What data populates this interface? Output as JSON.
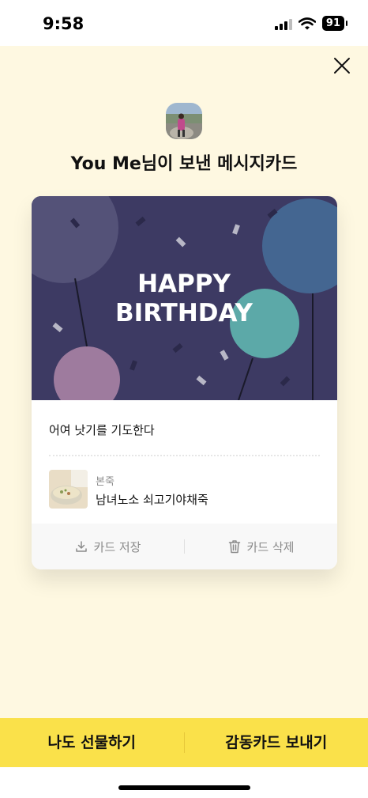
{
  "status_bar": {
    "time": "9:58",
    "battery": "91",
    "signal_icon": "cellular-signal-icon",
    "wifi_icon": "wifi-icon"
  },
  "header": {
    "close_icon": "close-icon",
    "title": "You Me님이 보낸 메시지카드"
  },
  "card": {
    "art": {
      "line1": "HAPPY",
      "line2": "BIRTHDAY",
      "background": "#3d3a63"
    },
    "message": "어여 낫기를 기도한다",
    "gift": {
      "brand": "본죽",
      "name": "남녀노소 쇠고기야채죽"
    },
    "actions": {
      "save_label": "카드 저장",
      "delete_label": "카드 삭제"
    }
  },
  "bottom_bar": {
    "gift_label": "나도 선물하기",
    "send_label": "감동카드 보내기",
    "accent": "#fae14a"
  },
  "colors": {
    "page_background": "#fef8e1"
  }
}
